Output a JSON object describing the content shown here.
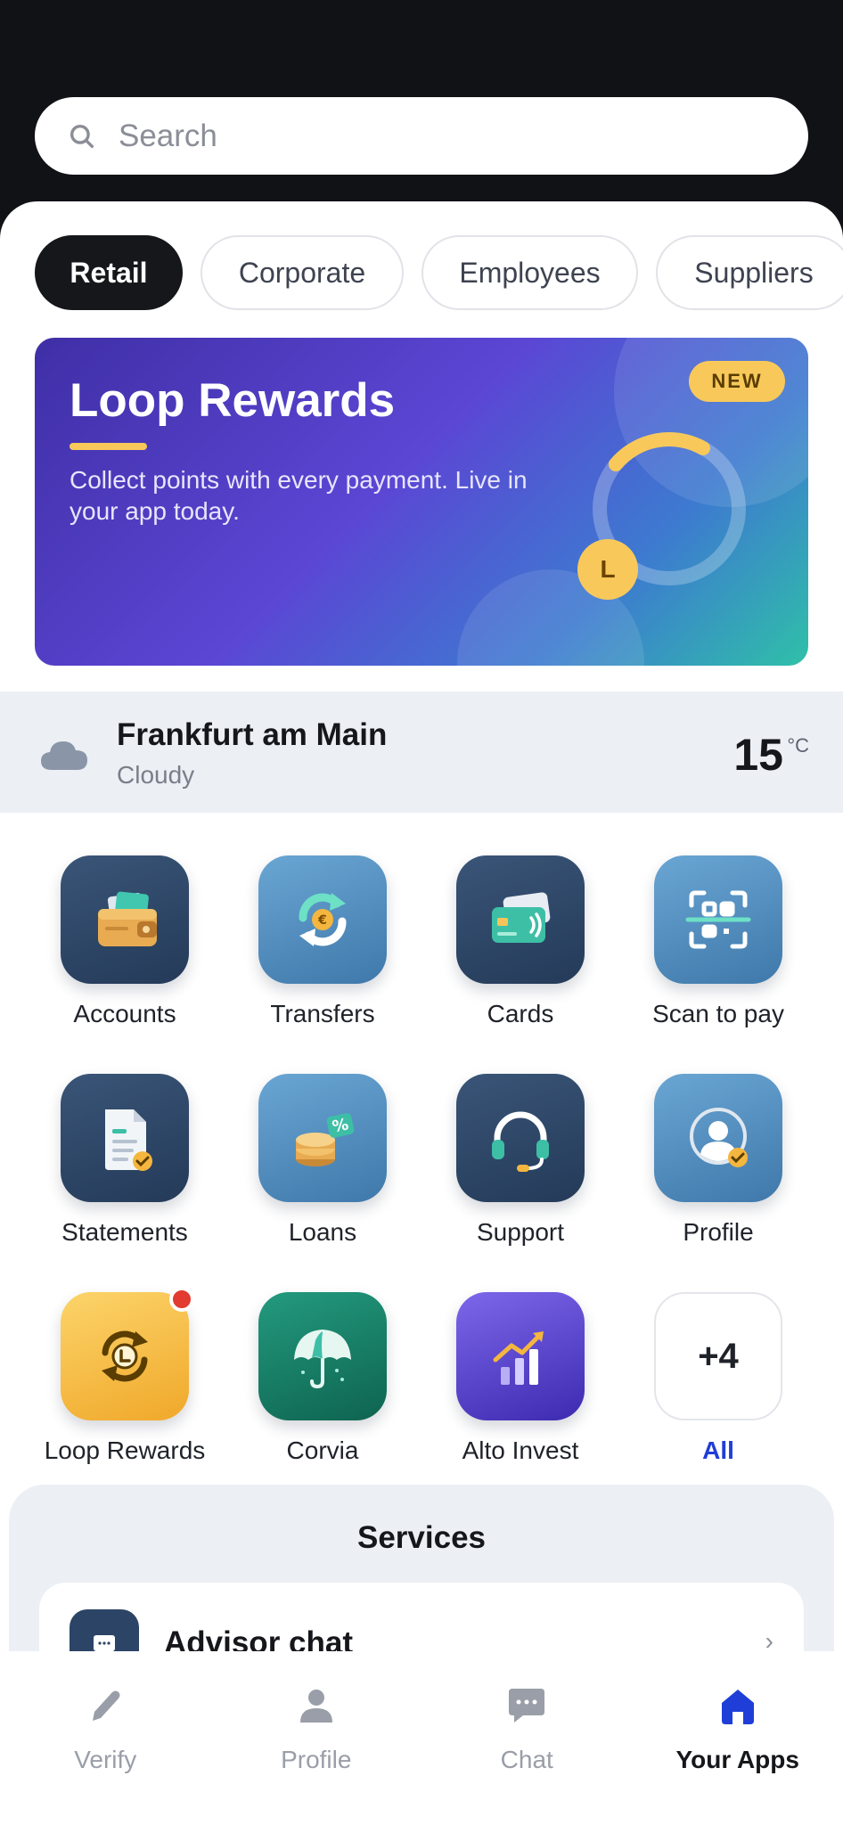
{
  "search": {
    "placeholder": "Search"
  },
  "segments": [
    "Retail",
    "Corporate",
    "Employees",
    "Suppliers"
  ],
  "banner": {
    "title": "Loop Rewards",
    "description": "Collect points with every payment. Live in your app today.",
    "badge": "NEW",
    "coin_letter": "L"
  },
  "weather": {
    "city": "Frankfurt am Main",
    "condition": "Cloudy",
    "temperature": "15",
    "unit": "°C"
  },
  "apps": [
    {
      "label": "Accounts",
      "icon": "wallet-icon"
    },
    {
      "label": "Transfers",
      "icon": "transfer-icon"
    },
    {
      "label": "Cards",
      "icon": "card-icon"
    },
    {
      "label": "Scan to pay",
      "icon": "qr-scan-icon"
    },
    {
      "label": "Statements",
      "icon": "statement-icon"
    },
    {
      "label": "Loans",
      "icon": "coins-icon"
    },
    {
      "label": "Support",
      "icon": "headset-icon"
    },
    {
      "label": "Profile",
      "icon": "profile-icon"
    },
    {
      "label": "Loop Rewards",
      "icon": "rewards-icon"
    },
    {
      "label": "Corvia",
      "icon": "umbrella-icon"
    },
    {
      "label": "Alto Invest",
      "icon": "chart-icon"
    },
    {
      "label": "All",
      "tile_text": "+4"
    }
  ],
  "services": {
    "title": "Services",
    "item": {
      "title": "Advisor chat",
      "chevron": "›"
    }
  },
  "tabbar": [
    {
      "label": "Verify",
      "icon": "pencil-icon"
    },
    {
      "label": "Profile",
      "icon": "person-icon"
    },
    {
      "label": "Chat",
      "icon": "chat-bubble-icon"
    },
    {
      "label": "Your Apps",
      "icon": "home-icon",
      "active": true
    }
  ],
  "colors": {
    "accent": "#1f3ed8",
    "dark": "#16171b",
    "banner_gradient": [
      "#3f2fa6",
      "#5b46d4",
      "#2fc0a8"
    ],
    "gold": "#f8c95a",
    "notification": "#e23b30"
  }
}
